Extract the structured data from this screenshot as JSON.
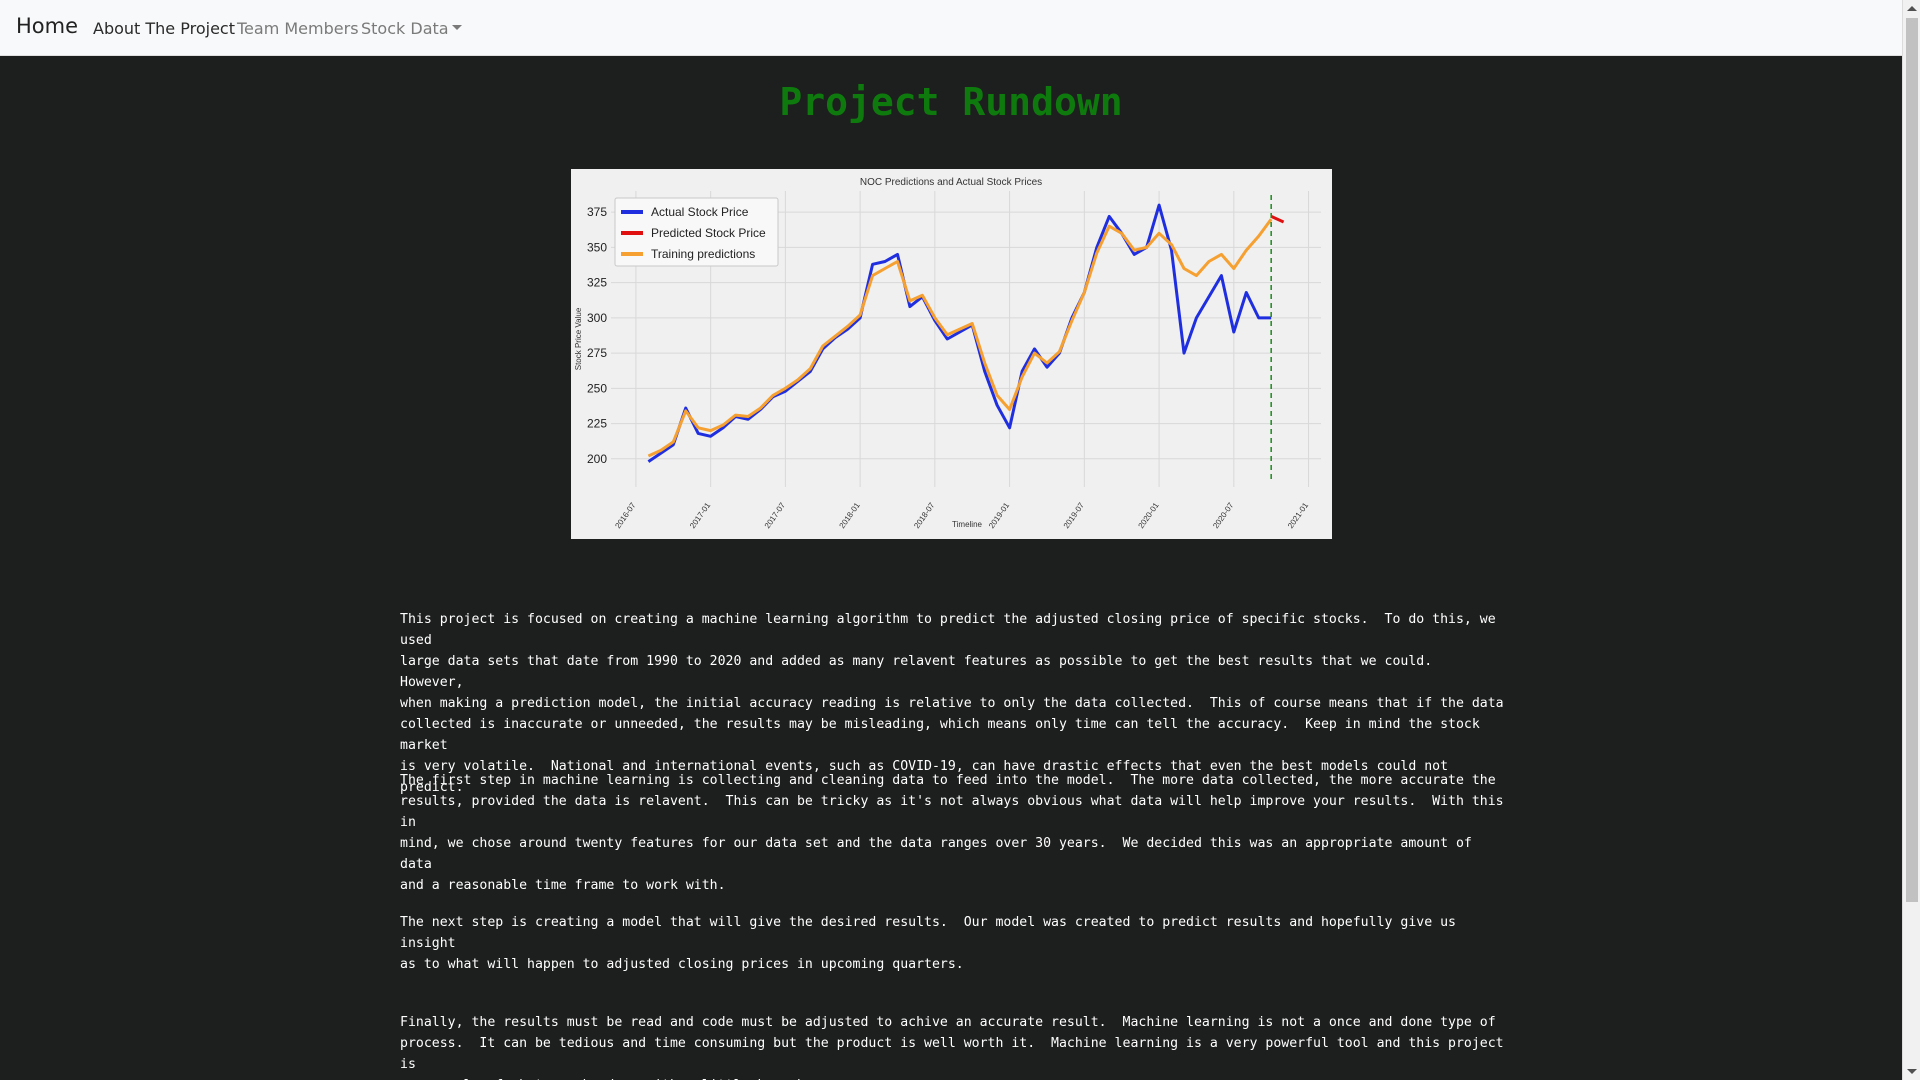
{
  "nav": {
    "brand": "Home",
    "links": [
      "About The Project",
      "Team Members",
      "Stock Data"
    ]
  },
  "page_title": "Project Rundown",
  "chart_data": {
    "type": "line",
    "title": "NOC Predictions and Actual Stock Prices",
    "xlabel": "Timeline",
    "ylabel": "Stock Price Value",
    "x_ticks": [
      "2016-07",
      "2017-01",
      "2017-07",
      "2018-01",
      "2018-07",
      "2019-01",
      "2019-07",
      "2020-01",
      "2020-07",
      "2021-01"
    ],
    "y_ticks": [
      200,
      225,
      250,
      275,
      300,
      325,
      350,
      375
    ],
    "ylim": [
      180,
      390
    ],
    "grid": true,
    "legend_position": "top-left",
    "split_marker": "2020-10",
    "series": [
      {
        "name": "Actual Stock Price",
        "color": "#1f2fe0",
        "x": [
          "2016-08",
          "2016-09",
          "2016-10",
          "2016-11",
          "2016-12",
          "2017-01",
          "2017-02",
          "2017-03",
          "2017-04",
          "2017-05",
          "2017-06",
          "2017-07",
          "2017-08",
          "2017-09",
          "2017-10",
          "2017-11",
          "2017-12",
          "2018-01",
          "2018-02",
          "2018-03",
          "2018-04",
          "2018-05",
          "2018-06",
          "2018-07",
          "2018-08",
          "2018-09",
          "2018-10",
          "2018-11",
          "2018-12",
          "2019-01",
          "2019-02",
          "2019-03",
          "2019-04",
          "2019-05",
          "2019-06",
          "2019-07",
          "2019-08",
          "2019-09",
          "2019-10",
          "2019-11",
          "2019-12",
          "2020-01",
          "2020-02",
          "2020-03",
          "2020-04",
          "2020-05",
          "2020-06",
          "2020-07",
          "2020-08",
          "2020-09",
          "2020-10"
        ],
        "values": [
          198,
          204,
          210,
          236,
          218,
          216,
          222,
          230,
          228,
          235,
          244,
          248,
          255,
          262,
          278,
          286,
          292,
          300,
          338,
          340,
          345,
          308,
          315,
          298,
          285,
          290,
          295,
          262,
          238,
          222,
          262,
          278,
          265,
          275,
          300,
          318,
          350,
          372,
          360,
          345,
          350,
          380,
          348,
          275,
          300,
          315,
          330,
          290,
          318,
          300,
          300
        ]
      },
      {
        "name": "Predicted Stock Price",
        "color": "#e01010",
        "x": [
          "2020-10",
          "2020-11"
        ],
        "values": [
          372,
          368
        ]
      },
      {
        "name": "Training predictions",
        "color": "#f5a030",
        "x": [
          "2016-08",
          "2016-09",
          "2016-10",
          "2016-11",
          "2016-12",
          "2017-01",
          "2017-02",
          "2017-03",
          "2017-04",
          "2017-05",
          "2017-06",
          "2017-07",
          "2017-08",
          "2017-09",
          "2017-10",
          "2017-11",
          "2017-12",
          "2018-01",
          "2018-02",
          "2018-03",
          "2018-04",
          "2018-05",
          "2018-06",
          "2018-07",
          "2018-08",
          "2018-09",
          "2018-10",
          "2018-11",
          "2018-12",
          "2019-01",
          "2019-02",
          "2019-03",
          "2019-04",
          "2019-05",
          "2019-06",
          "2019-07",
          "2019-08",
          "2019-09",
          "2019-10",
          "2019-11",
          "2019-12",
          "2020-01",
          "2020-02",
          "2020-03",
          "2020-04",
          "2020-05",
          "2020-06",
          "2020-07",
          "2020-08",
          "2020-09",
          "2020-10"
        ],
        "values": [
          202,
          206,
          212,
          234,
          222,
          220,
          224,
          231,
          230,
          236,
          245,
          250,
          256,
          264,
          280,
          287,
          294,
          302,
          330,
          335,
          340,
          312,
          316,
          300,
          288,
          292,
          296,
          268,
          245,
          235,
          258,
          275,
          268,
          276,
          298,
          318,
          346,
          365,
          360,
          348,
          350,
          360,
          352,
          335,
          330,
          340,
          345,
          335,
          348,
          358,
          370
        ]
      }
    ]
  },
  "paragraphs": [
    "This project is focused on creating a machine learning algorithm to predict the adjusted closing price of specific stocks.  To do this, we used\nlarge data sets that date from 1990 to 2020 and added as many relavent features as possible to get the best results that we could.  However,\nwhen making a prediction model, the initial accuracy reading is relative to only the data collected.  This of course means that if the data\ncollected is inaccurate or unneeded, the results may be misleading, which means only time can tell the accuracy.  Keep in mind the stock market\nis very volatile.  National and international events, such as COVID-19, can have drastic effects that even the best models could not predict.",
    "The first step in machine learning is collecting and cleaning data to feed into the model.  The more data collected, the more accurate the\nresults, provided the data is relavent.  This can be tricky as it's not always obvious what data will help improve your results.  With this in\nmind, we chose around twenty features for our data set and the data ranges over 30 years.  We decided this was an appropriate amount of data\nand a reasonable time frame to work with.",
    "The next step is creating a model that will give the desired results.  Our model was created to predict results and hopefully give us insight\nas to what will happen to adjusted closing prices in upcoming quarters.",
    "Finally, the results must be read and code must be adjusted to achive an accurate result.  Machine learning is not a once and done type of\nprocess.  It can be tedious and time consuming but the product is well worth it.  Machine learning is a very powerful tool and this project is\nan example of what can be done with a little know how."
  ]
}
